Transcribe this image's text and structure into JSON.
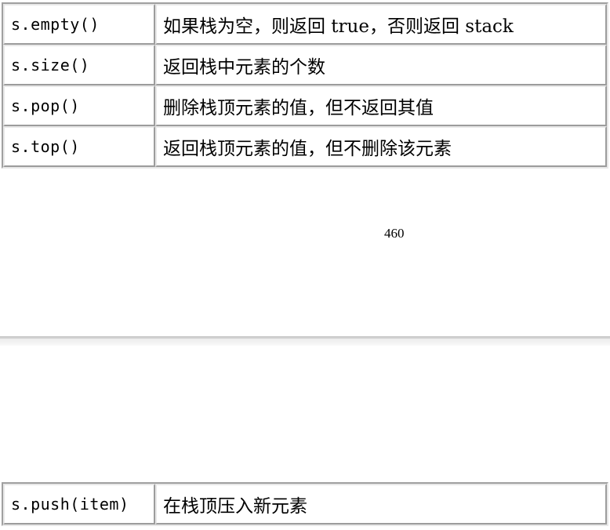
{
  "table_top": {
    "rows": [
      {
        "method": "s.empty()",
        "desc": "如果栈为空，则返回 true，否则返回 stack"
      },
      {
        "method": "s.size()",
        "desc": "返回栈中元素的个数"
      },
      {
        "method": "s.pop()",
        "desc": "删除栈顶元素的值，但不返回其值"
      },
      {
        "method": "s.top()",
        "desc": "返回栈顶元素的值，但不删除该元素"
      }
    ]
  },
  "page": {
    "number": "460"
  },
  "table_bottom": {
    "rows": [
      {
        "method": "s.push(item)",
        "desc": "在栈顶压入新元素"
      }
    ]
  }
}
